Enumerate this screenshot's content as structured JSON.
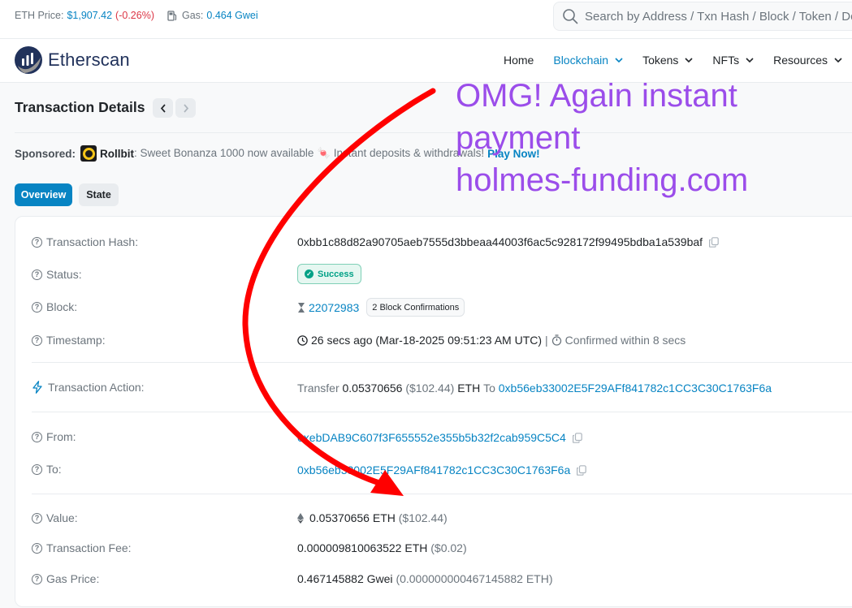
{
  "topbar": {
    "eth_price_label": "ETH Price:",
    "eth_price_value": "$1,907.42",
    "eth_price_change": "(-0.26%)",
    "gas_label": "Gas:",
    "gas_value": "0.464 Gwei",
    "search_placeholder": "Search by Address / Txn Hash / Block / Token / Domain Name"
  },
  "header": {
    "brand": "Etherscan",
    "nav": {
      "home": "Home",
      "blockchain": "Blockchain",
      "tokens": "Tokens",
      "nfts": "NFTs",
      "resources": "Resources"
    }
  },
  "page": {
    "title": "Transaction Details",
    "sponsored_label": "Sponsored:",
    "sponsor_brand": "Rollbit",
    "sponsor_text": ": Sweet Bonanza 1000 now available 🍬 Instant deposits & withdrawals!",
    "sponsor_cta": "Play Now!",
    "tabs": {
      "overview": "Overview",
      "state": "State"
    }
  },
  "details": {
    "hash_label": "Transaction Hash:",
    "hash_value": "0xbb1c88d82a90705aeb7555d3bbeaa44003f6ac5c928172f99495bdba1a539baf",
    "status_label": "Status:",
    "status_value": "Success",
    "block_label": "Block:",
    "block_value": "22072983",
    "block_confirmations": "2 Block Confirmations",
    "timestamp_label": "Timestamp:",
    "timestamp_value": "26 secs ago (Mar-18-2025 09:51:23 AM UTC)",
    "timestamp_sep": "|",
    "confirmed_value": "Confirmed within 8 secs",
    "action_label": "Transaction Action:",
    "action_prefix": "Transfer",
    "action_amount": "0.05370656",
    "action_usd": "($102.44)",
    "action_token": "ETH",
    "action_to": "To",
    "action_to_address": "0xb56eb33002E5F29AFf841782c1CC3C30C1763F6a",
    "from_label": "From:",
    "from_value": "0xebDAB9C607f3F655552e355b5b32f2cab959C5C4",
    "to_label": "To:",
    "to_value": "0xb56eb33002E5F29AFf841782c1CC3C30C1763F6a",
    "value_label": "Value:",
    "value_amount": "0.05370656 ETH",
    "value_usd": "($102.44)",
    "fee_label": "Transaction Fee:",
    "fee_amount": "0.000009810063522 ETH",
    "fee_usd": "($0.02)",
    "gas_price_label": "Gas Price:",
    "gas_price_value": "0.467145882 Gwei",
    "gas_price_eth": "(0.000000000467145882 ETH)"
  },
  "overlay": {
    "line1": "OMG! Again instant",
    "line2": "payment",
    "line3": "holmes-funding.com",
    "text_color": "#9b4dea",
    "arrow_color": "#ff0000"
  },
  "colors": {
    "link": "#0784c3",
    "negative": "#dc3545",
    "success": "#00a186"
  }
}
